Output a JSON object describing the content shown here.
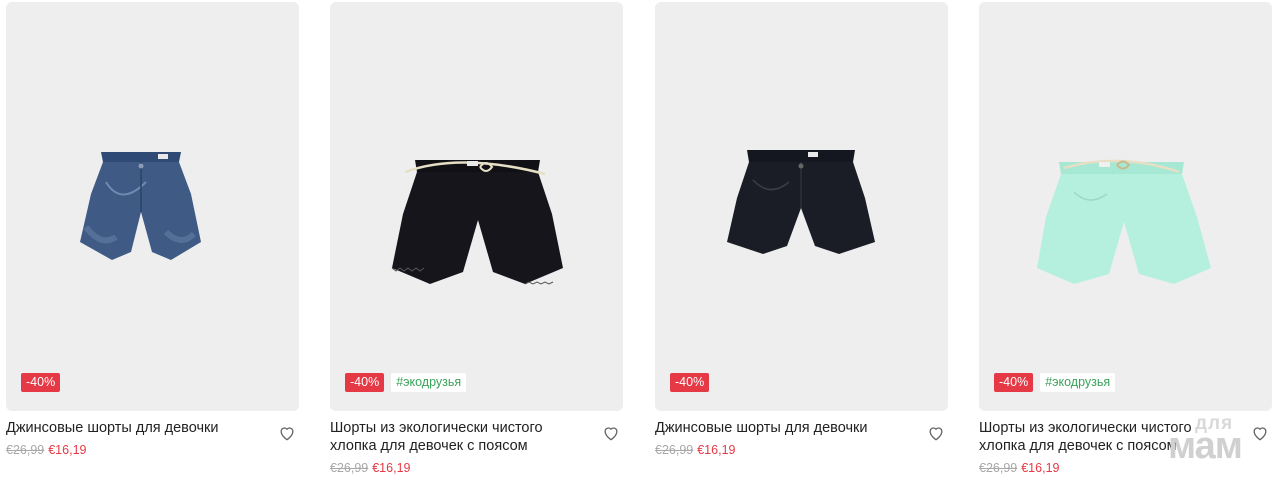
{
  "products": [
    {
      "name": "Джинсовые шорты для девочки",
      "old_price": "€26,99",
      "new_price": "€16,19",
      "discount": "-40%",
      "tag": "",
      "color": "#3e5a85"
    },
    {
      "name": "Шорты из экологически чистого хлопка для девочек с поясом",
      "old_price": "€26,99",
      "new_price": "€16,19",
      "discount": "-40%",
      "tag": "#экодрузья",
      "color": "#15151b"
    },
    {
      "name": "Джинсовые шорты для девочки",
      "old_price": "€26,99",
      "new_price": "€16,19",
      "discount": "-40%",
      "tag": "",
      "color": "#1b1d26"
    },
    {
      "name": "Шорты из экологически чистого хлопка для девочек с поясом",
      "old_price": "€26,99",
      "new_price": "€16,19",
      "discount": "-40%",
      "tag": "#экодрузья",
      "color": "#b5f0de"
    }
  ],
  "watermark": {
    "line1": "для",
    "line2": "мам"
  },
  "icons": {
    "favorite": "heart-outline-icon"
  }
}
